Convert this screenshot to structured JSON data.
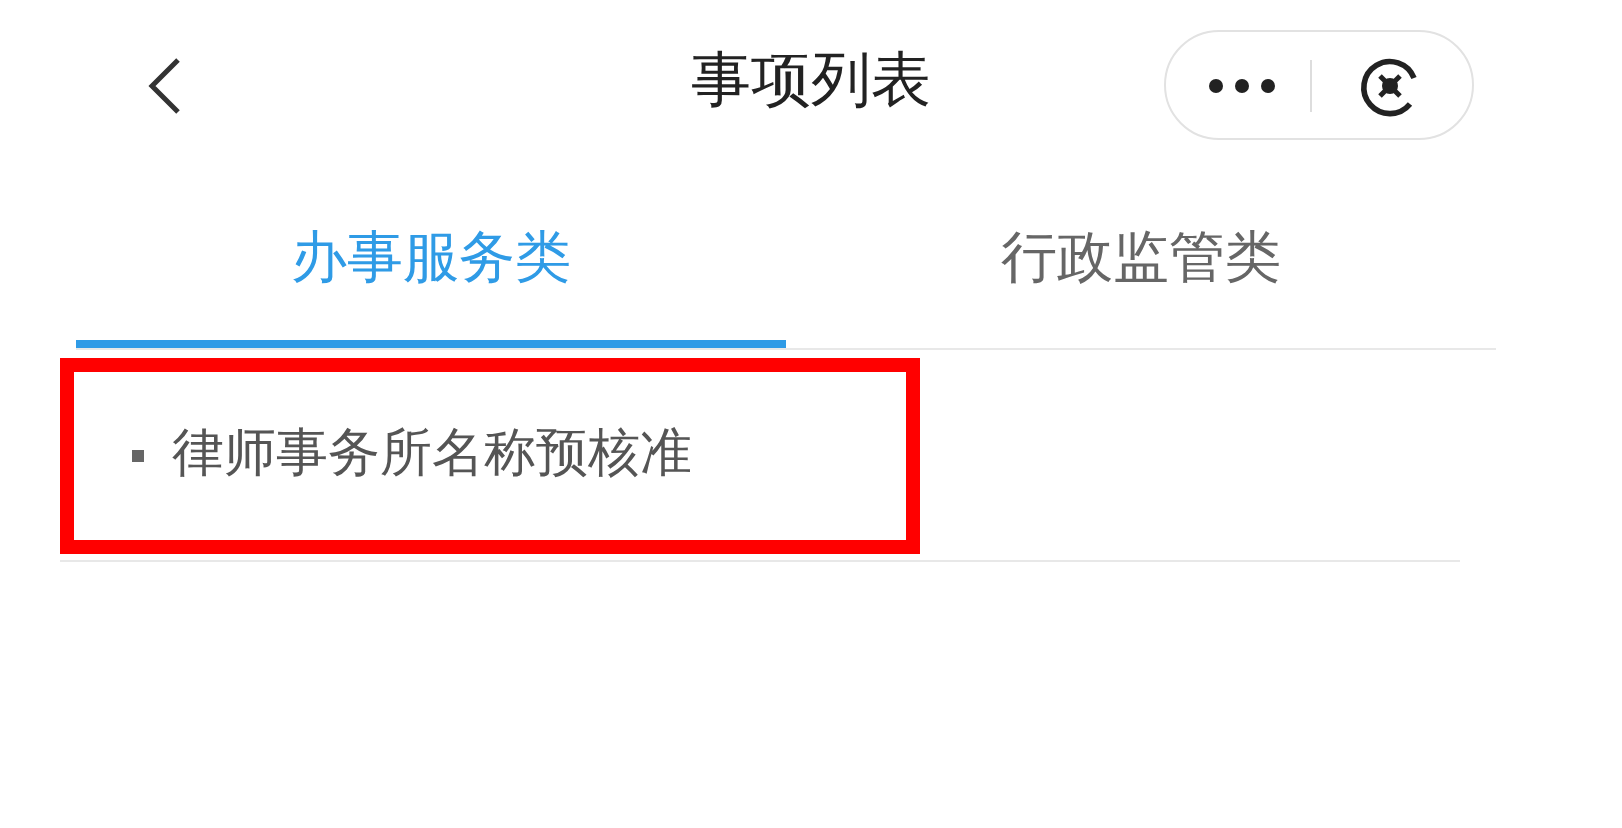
{
  "header": {
    "title": "事项列表"
  },
  "tabs": [
    {
      "label": "办事服务类",
      "selected": true
    },
    {
      "label": "行政监管类",
      "selected": false
    }
  ],
  "items": [
    {
      "label": "律师事务所名称预核准",
      "highlighted": true
    }
  ]
}
